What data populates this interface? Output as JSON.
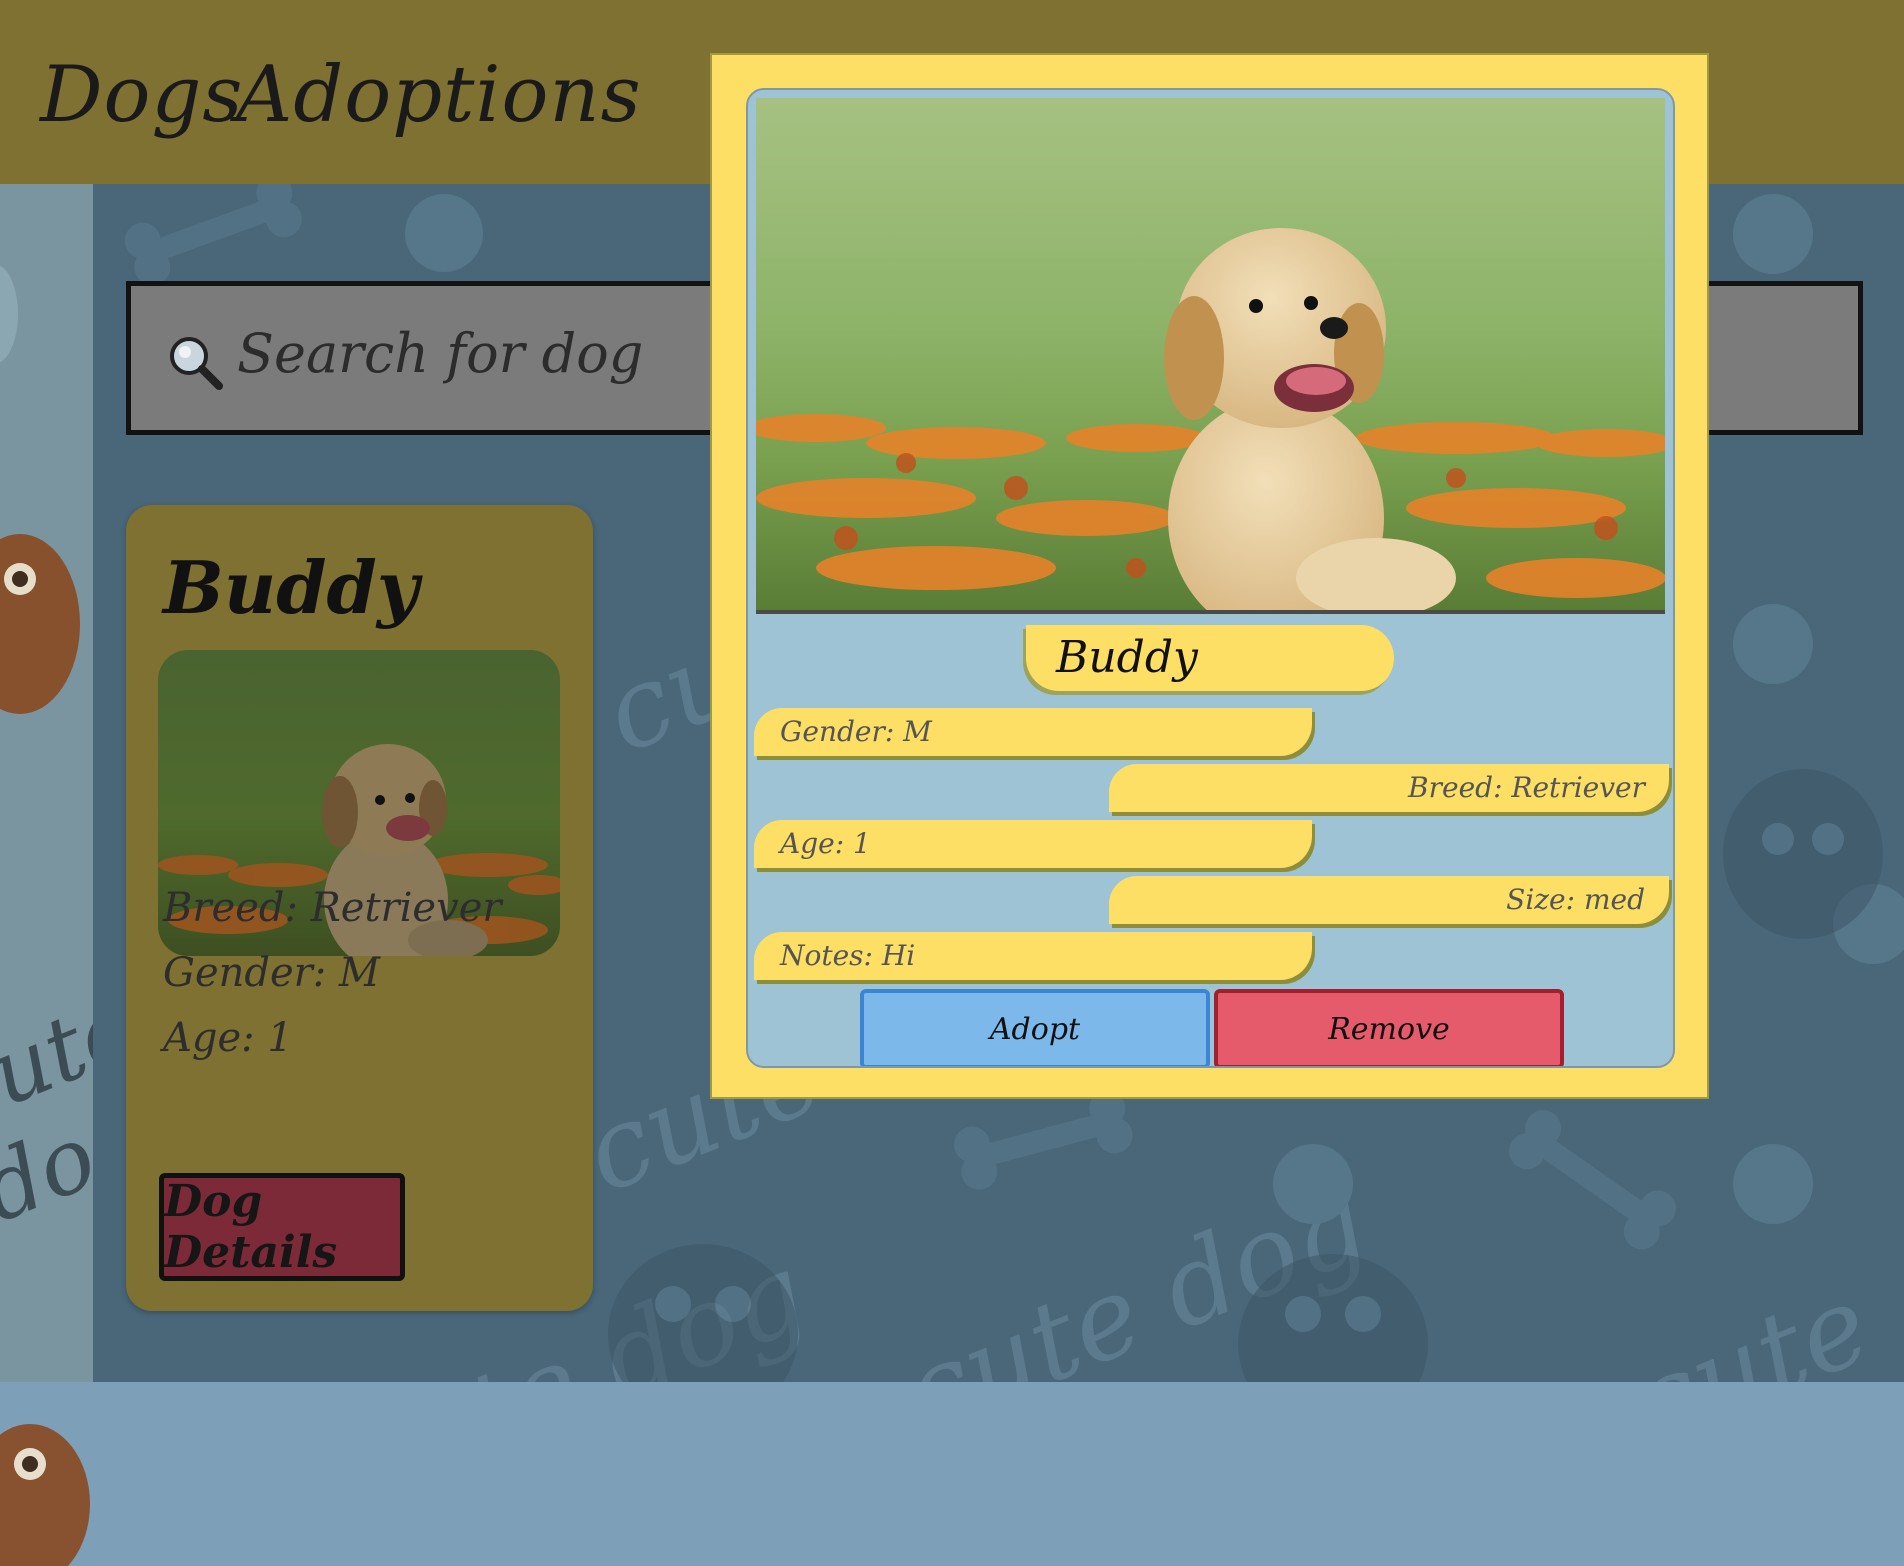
{
  "nav": {
    "items": [
      {
        "label": "Dogs"
      },
      {
        "label": "Adoptions"
      }
    ]
  },
  "search": {
    "placeholder": "Search for dog",
    "icon": "magnifier-icon"
  },
  "card": {
    "name": "Buddy",
    "breed": "Breed: Retriever",
    "gender": "Gender: M",
    "age": "Age: 1",
    "details_label": "Dog Details"
  },
  "modal": {
    "name": "Buddy",
    "fields": {
      "gender": "Gender: M",
      "breed": "Breed: Retriever",
      "age": "Age: 1",
      "size": "Size: med",
      "notes": "Notes: Hi"
    },
    "adopt_label": "Adopt",
    "remove_label": "Remove"
  },
  "background": {
    "watermark_text": "cute dog"
  },
  "colors": {
    "header": "#7e7131",
    "modal": "#fddf65",
    "adopt": "#7cb9ea",
    "remove": "#e55b6c",
    "details": "#7c2a38"
  }
}
